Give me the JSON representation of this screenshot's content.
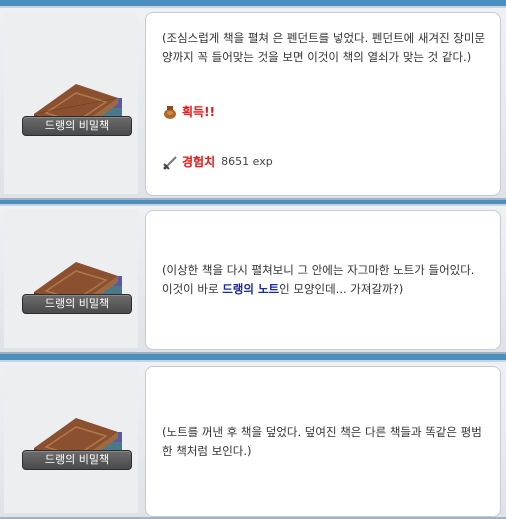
{
  "npc": {
    "name": "드랭의 비밀책"
  },
  "panels": [
    {
      "text": "(조심스럽게 책을 펼쳐 은 펜던트를 넣었다. 펜던트에 새겨진 장미문양까지 꼭 들어맞는 것을 보면 이것이 책의 열쇠가 맞는 것 같다.)",
      "reward": {
        "item_label": "획득!!",
        "exp_label": "경험치",
        "exp_value": "8651 exp"
      }
    },
    {
      "text_before": "(이상한 책을 다시 펼쳐보니 그 안에는 자그마한 노트가 들어있다. 이것이 바로 ",
      "highlight": "드랭의 노트",
      "text_after": "인 모양인데... 가져갈까?)"
    },
    {
      "text": "(노트를 꺼낸 후 책을 덮었다. 덮여진 책은 다른 책들과 똑같은 평범한 책처럼 보인다.)"
    }
  ],
  "colors": {
    "frame": "#4a8fc0",
    "reward_red": "#e02020",
    "highlight_blue": "#1a2a9a"
  },
  "icons": [
    "book-icon",
    "bag-icon",
    "sword-icon"
  ]
}
